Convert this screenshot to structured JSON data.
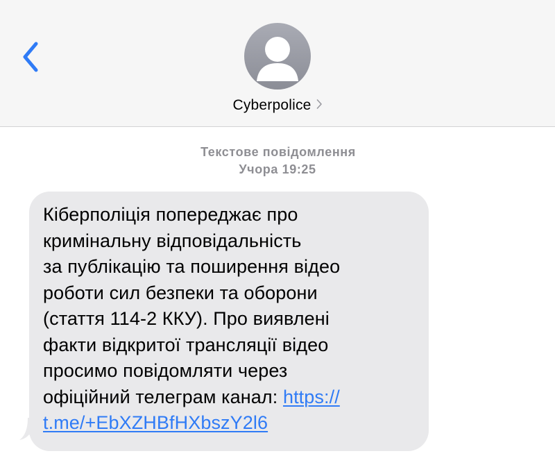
{
  "header": {
    "contact_name": "Cyberpolice",
    "accent_color": "#2f7bf6"
  },
  "icons": {
    "back": "chevron-left-icon",
    "avatar": "person-silhouette-icon",
    "contact_detail": "chevron-right-icon"
  },
  "conversation": {
    "message_type": "Текстове повідомлення",
    "timestamp": "Учора 19:25"
  },
  "message": {
    "lines": [
      "Кіберполіція попереджає про",
      "кримінальну відповідальність",
      "за публікацію та поширення відео",
      "роботи сил безпеки та оборони",
      "(стаття 114-2 ККУ). Про виявлені",
      "факти відкритої трансляції відео",
      "просимо повідомляти через",
      "офіційний телеграм канал: "
    ],
    "link_part_1": "https://",
    "link_part_2": "t.me/+EbXZHBfHXbszY2l6",
    "bubble_color": "#e9e9eb"
  }
}
